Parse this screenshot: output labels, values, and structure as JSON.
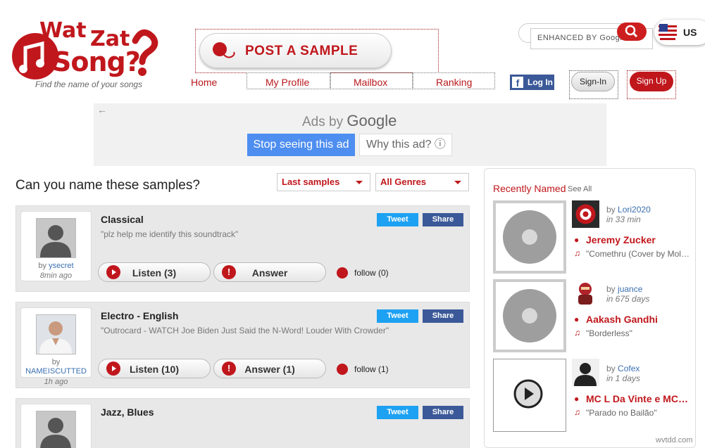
{
  "brand": {
    "logo_wat": "Wat",
    "logo_zat": "Zat",
    "logo_song": "Song?",
    "tagline": "Find the name of your songs"
  },
  "post": {
    "label": "POST A SAMPLE"
  },
  "nav": {
    "home": "Home",
    "profile": "My Profile",
    "mailbox": "Mailbox",
    "ranking": "Ranking"
  },
  "search": {
    "placeholder": "ENHANCED BY Google"
  },
  "lang": {
    "label": "US"
  },
  "auth": {
    "facebook": "Log In",
    "signin": "Sign-In",
    "signup": "Sign Up"
  },
  "ad": {
    "back": "←",
    "ads_by": "Ads by",
    "google": "Google",
    "stop": "Stop seeing this ad",
    "why": "Why this ad? ⓘ"
  },
  "main": {
    "title": "Can you name these samples?",
    "filter_sort": "Last samples",
    "filter_genre": "All Genres"
  },
  "samples": [
    {
      "genre": "Classical",
      "desc": "\"plz help me identify this soundtrack\"",
      "by": "by",
      "user": "ysecret",
      "when": "8min ago",
      "listen": "Listen (3)",
      "answer": "Answer",
      "follow": "follow (0)",
      "tweet": "Tweet",
      "share": "Share"
    },
    {
      "genre": "Electro - English",
      "desc": "\"Outrocard - WATCH Joe Biden Just Said the N-Word! Louder With Crowder\"",
      "by": "by",
      "user": "NAMEISCUTTED",
      "when": "1h ago",
      "listen": "Listen (10)",
      "answer": "Answer (1)",
      "follow": "follow (1)",
      "tweet": "Tweet",
      "share": "Share"
    },
    {
      "genre": "Jazz, Blues",
      "tweet": "Tweet",
      "share": "Share"
    }
  ],
  "recent": {
    "title": "Recently Named",
    "see_all": "See All",
    "items": [
      {
        "by": "by",
        "user": "Lori2020",
        "when": "in 33 min",
        "artist": "Jeremy Zucker",
        "song": "\"Comethru (Cover by Mol…"
      },
      {
        "by": "by",
        "user": "juance",
        "when": "in 675 days",
        "artist": "Aakash Gandhi",
        "song": "\"Borderless\""
      },
      {
        "by": "by",
        "user": "Cofex",
        "when": "in 1 days",
        "artist": "MC L Da Vinte e MC…",
        "song": "\"Parado no Bailão\""
      }
    ]
  },
  "watermark": "wvtdd.com",
  "colors": {
    "brand_red": "#c0171c",
    "twitter": "#1da1f2",
    "facebook": "#3b5998",
    "ad_blue": "#4e8ef0"
  }
}
